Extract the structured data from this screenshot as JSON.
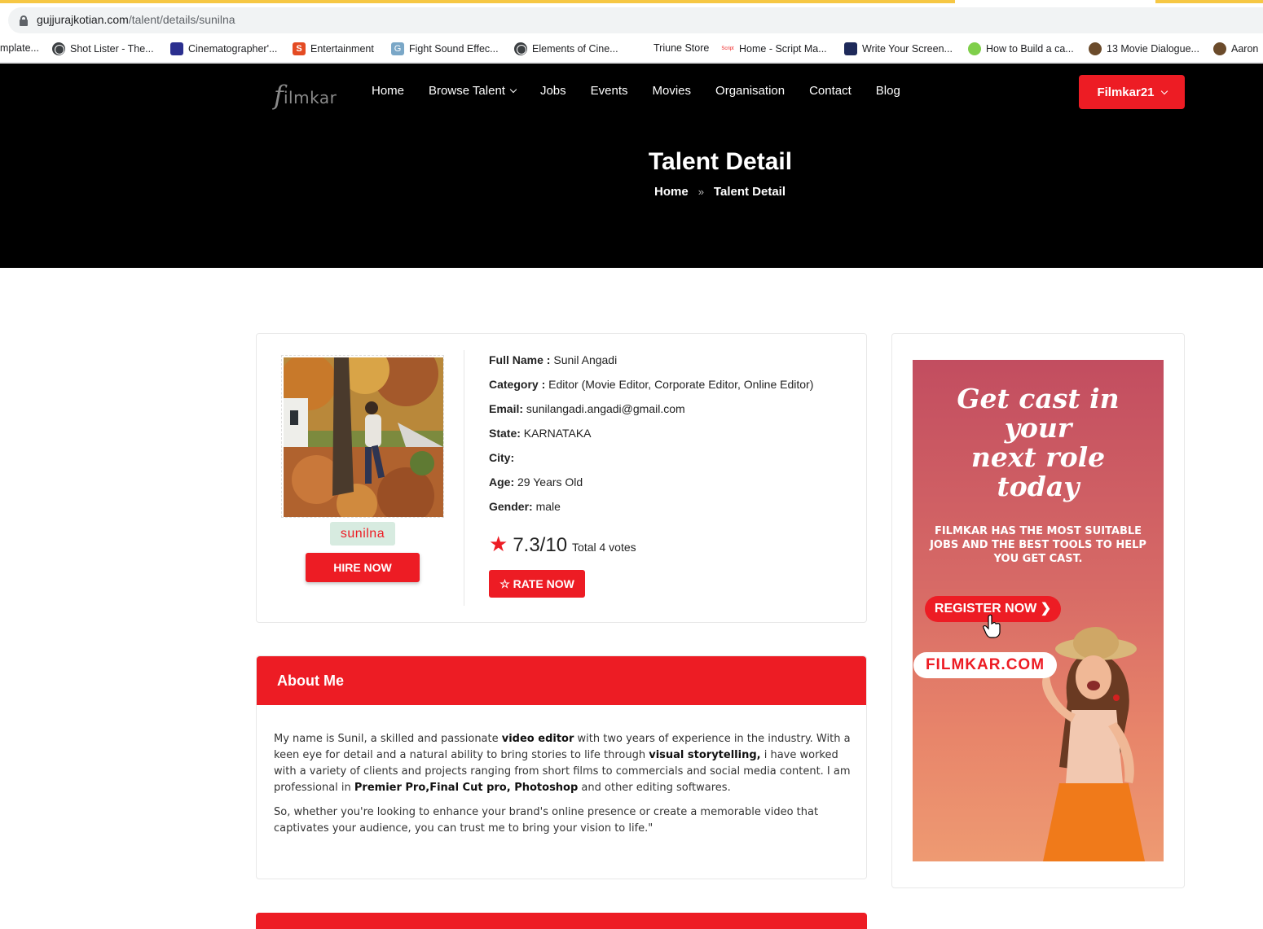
{
  "browser": {
    "url_host": "gujjurajkotian.com",
    "url_path": "/talent/details/sunilna",
    "bookmarks": [
      {
        "label": "mplate...",
        "icon": "none"
      },
      {
        "label": "Shot Lister - The...",
        "icon": "globe-icon"
      },
      {
        "label": "Cinematographer'...",
        "icon": "film-icon"
      },
      {
        "label": "Entertainment",
        "icon": "s-icon"
      },
      {
        "label": "Fight Sound Effec...",
        "icon": "g-icon"
      },
      {
        "label": "Elements of Cine...",
        "icon": "globe-icon"
      },
      {
        "label": "Triune Store",
        "icon": "none"
      },
      {
        "label": "Home - Script Ma...",
        "icon": "script-icon"
      },
      {
        "label": "Write Your Screen...",
        "icon": "write-icon"
      },
      {
        "label": "How to Build a ca...",
        "icon": "build-icon"
      },
      {
        "label": "13 Movie Dialogue...",
        "icon": "camera-icon"
      },
      {
        "label": "Aaron",
        "icon": "camera-icon"
      }
    ]
  },
  "header": {
    "logo_first": "f",
    "logo_rest": "ilmkar",
    "nav": [
      "Home",
      "Browse Talent",
      "Jobs",
      "Events",
      "Movies",
      "Organisation",
      "Contact",
      "Blog"
    ],
    "user_button": "Filmkar21",
    "page_title": "Talent Detail",
    "breadcrumb": {
      "home": "Home",
      "current": "Talent Detail"
    }
  },
  "profile": {
    "username": "sunilna",
    "hire_label": "HIRE NOW",
    "fields": [
      {
        "label": "Full Name :",
        "value": "Sunil Angadi"
      },
      {
        "label": "Category :",
        "value": "Editor (Movie Editor, Corporate Editor, Online Editor)"
      },
      {
        "label": "Email:",
        "value": "sunilangadi.angadi@gmail.com"
      },
      {
        "label": "State:",
        "value": "KARNATAKA"
      },
      {
        "label": "City:",
        "value": ""
      },
      {
        "label": "Age:",
        "value": "29 Years Old"
      },
      {
        "label": "Gender:",
        "value": "male"
      }
    ],
    "rating_value": "7.3/10",
    "rating_total": "Total 4 votes",
    "rate_label": "☆ RATE NOW"
  },
  "about": {
    "title": "About Me",
    "p1": [
      {
        "t": "My name is Sunil, a skilled and passionate ",
        "b": false
      },
      {
        "t": "video editor",
        "b": true
      },
      {
        "t": " with two years of experience in the industry. With a keen eye for detail and a natural ability to bring stories to life through ",
        "b": false
      },
      {
        "t": "visual storytelling,",
        "b": true
      },
      {
        "t": " i have worked with a variety of clients and projects ranging from short films to commercials and social media content. I am professional in ",
        "b": false
      },
      {
        "t": "Premier Pro,Final Cut pro, Photoshop",
        "b": true
      },
      {
        "t": " and other editing softwares.",
        "b": false
      }
    ],
    "p2": "So, whether you're looking to enhance your brand's online presence or create a memorable video that captivates your audience, you can trust me to bring your vision to life.\""
  },
  "ad": {
    "headline_1": "Get cast in",
    "headline_2": "your",
    "headline_3": "next role",
    "headline_4": "today",
    "sub": "FILMKAR HAS THE MOST SUITABLE JOBS AND THE BEST TOOLS  TO HELP YOU GET CAST.",
    "register": "REGISTER  NOW ❯",
    "site": "FILMKAR.COM"
  },
  "colors": {
    "accent": "#ed1c24",
    "header_bg": "#000000",
    "badge_bg": "#d7ebe0"
  }
}
